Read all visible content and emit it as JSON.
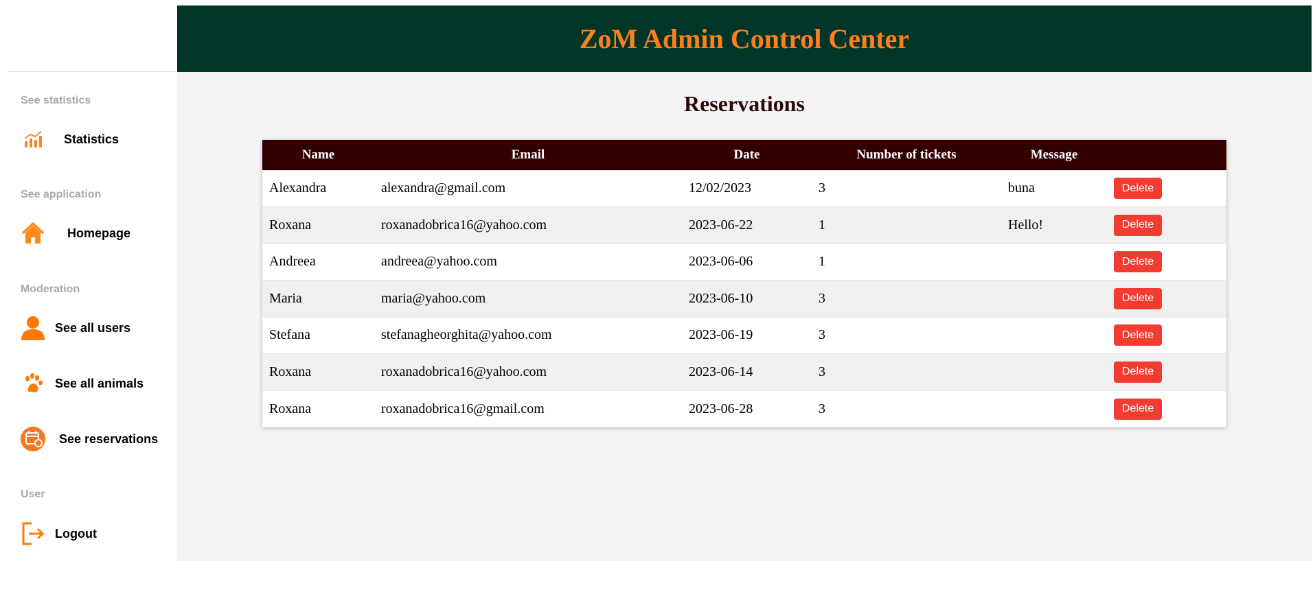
{
  "header": {
    "title": "ZoM Admin Control Center"
  },
  "sidebar": {
    "sections": [
      {
        "label": "See statistics"
      },
      {
        "label": "See application"
      },
      {
        "label": "Moderation"
      },
      {
        "label": "User"
      }
    ],
    "items": [
      {
        "label": "Statistics",
        "icon": "chart-icon"
      },
      {
        "label": "Homepage",
        "icon": "home-icon"
      },
      {
        "label": "See all users",
        "icon": "user-icon"
      },
      {
        "label": "See all animals",
        "icon": "paw-icon"
      },
      {
        "label": "See reservations",
        "icon": "calendar-icon"
      },
      {
        "label": "Logout",
        "icon": "logout-icon"
      }
    ]
  },
  "main": {
    "title": "Reservations",
    "table": {
      "columns": [
        "Name",
        "Email",
        "Date",
        "Number of tickets",
        "Message",
        ""
      ],
      "delete_label": "Delete",
      "rows": [
        {
          "name": "Alexandra",
          "email": "alexandra@gmail.com",
          "date": "12/02/2023",
          "tickets": "3",
          "message": "buna"
        },
        {
          "name": "Roxana",
          "email": "roxanadobrica16@yahoo.com",
          "date": "2023-06-22",
          "tickets": "1",
          "message": "Hello!"
        },
        {
          "name": "Andreea",
          "email": "andreea@yahoo.com",
          "date": "2023-06-06",
          "tickets": "1",
          "message": ""
        },
        {
          "name": "Maria",
          "email": "maria@yahoo.com",
          "date": "2023-06-10",
          "tickets": "3",
          "message": ""
        },
        {
          "name": "Stefana",
          "email": "stefanagheorghita@yahoo.com",
          "date": "2023-06-19",
          "tickets": "3",
          "message": ""
        },
        {
          "name": "Roxana",
          "email": "roxanadobrica16@yahoo.com",
          "date": "2023-06-14",
          "tickets": "3",
          "message": ""
        },
        {
          "name": "Roxana",
          "email": "roxanadobrica16@gmail.com",
          "date": "2023-06-28",
          "tickets": "3",
          "message": ""
        }
      ]
    }
  },
  "colors": {
    "accent": "#ff7f1c",
    "header_bg": "#013528",
    "table_header_bg": "#330000",
    "delete": "#f23c32"
  }
}
